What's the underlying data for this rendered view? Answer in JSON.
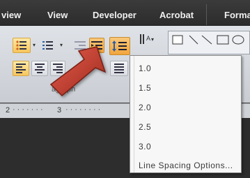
{
  "tabs": [
    {
      "label": "view"
    },
    {
      "label": "View"
    },
    {
      "label": "Developer"
    },
    {
      "label": "Acrobat"
    },
    {
      "label": "Forma"
    }
  ],
  "ribbon": {
    "paragraph_group_label": "agraph"
  },
  "ruler": {
    "numbers": [
      "2",
      "3"
    ]
  },
  "line_spacing_menu": {
    "items": [
      {
        "label": "1.0"
      },
      {
        "label": "1.5"
      },
      {
        "label": "2.0"
      },
      {
        "label": "2.5"
      },
      {
        "label": "3.0"
      }
    ],
    "options_label": "Line Spacing Options..."
  },
  "colors": {
    "highlight": "#f7c65c",
    "arrow": "#c0392b"
  }
}
